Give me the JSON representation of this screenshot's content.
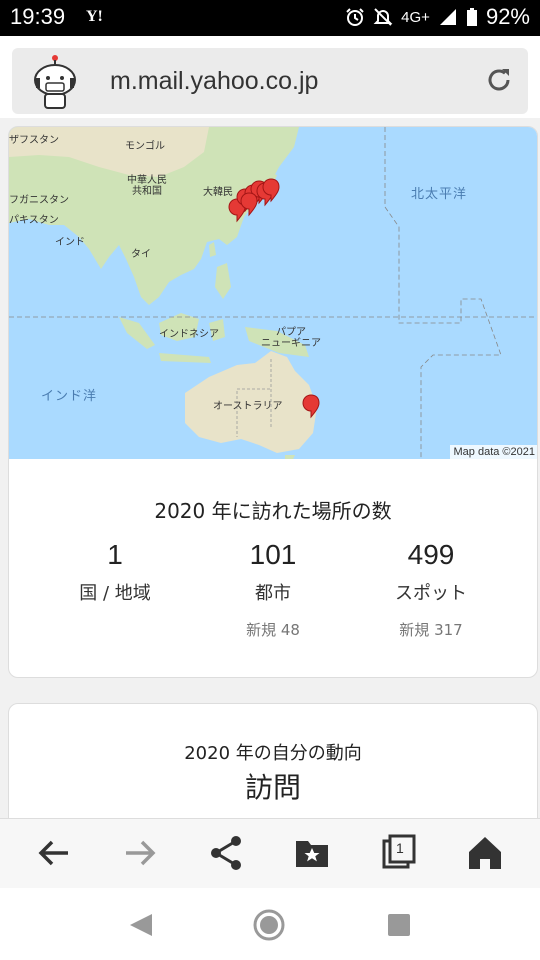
{
  "status_bar": {
    "time": "19:39",
    "app_icon": "Y!",
    "network": "4G+",
    "battery": "92%"
  },
  "browser": {
    "url": "m.mail.yahoo.co.jp"
  },
  "map": {
    "attribution": "Map data ©2021",
    "labels": {
      "afghanistan_partial": "ザフスタン",
      "mongolia": "モンゴル",
      "china": "中華人民\n共和国",
      "korea": "大韓民",
      "afghanistan": "フガニスタン",
      "pakistan": "パキスタン",
      "india": "インド",
      "thailand": "タイ",
      "indonesia": "インドネシア",
      "png": "パプア\nニューギニア",
      "australia": "オーストラリア",
      "north_pacific": "北太平洋",
      "indian_ocean": "インド洋"
    },
    "marker_color": "#e53935"
  },
  "summary": {
    "title": "2020 年に訪れた場所の数",
    "stats": [
      {
        "value": "1",
        "label": "国 / 地域",
        "new": ""
      },
      {
        "value": "101",
        "label": "都市",
        "new": "新規 48"
      },
      {
        "value": "499",
        "label": "スポット",
        "new": "新規 317"
      }
    ]
  },
  "movement": {
    "subtitle": "2020 年の自分の動向",
    "heading": "訪問"
  },
  "toolbar": {
    "icons": [
      "back-arrow-icon",
      "forward-arrow-icon",
      "share-icon",
      "bookmark-folder-icon",
      "tabs-icon",
      "home-icon"
    ],
    "tab_count": "1"
  },
  "navbar": {
    "icons": [
      "nav-back-icon",
      "nav-home-icon",
      "nav-recents-icon"
    ]
  }
}
